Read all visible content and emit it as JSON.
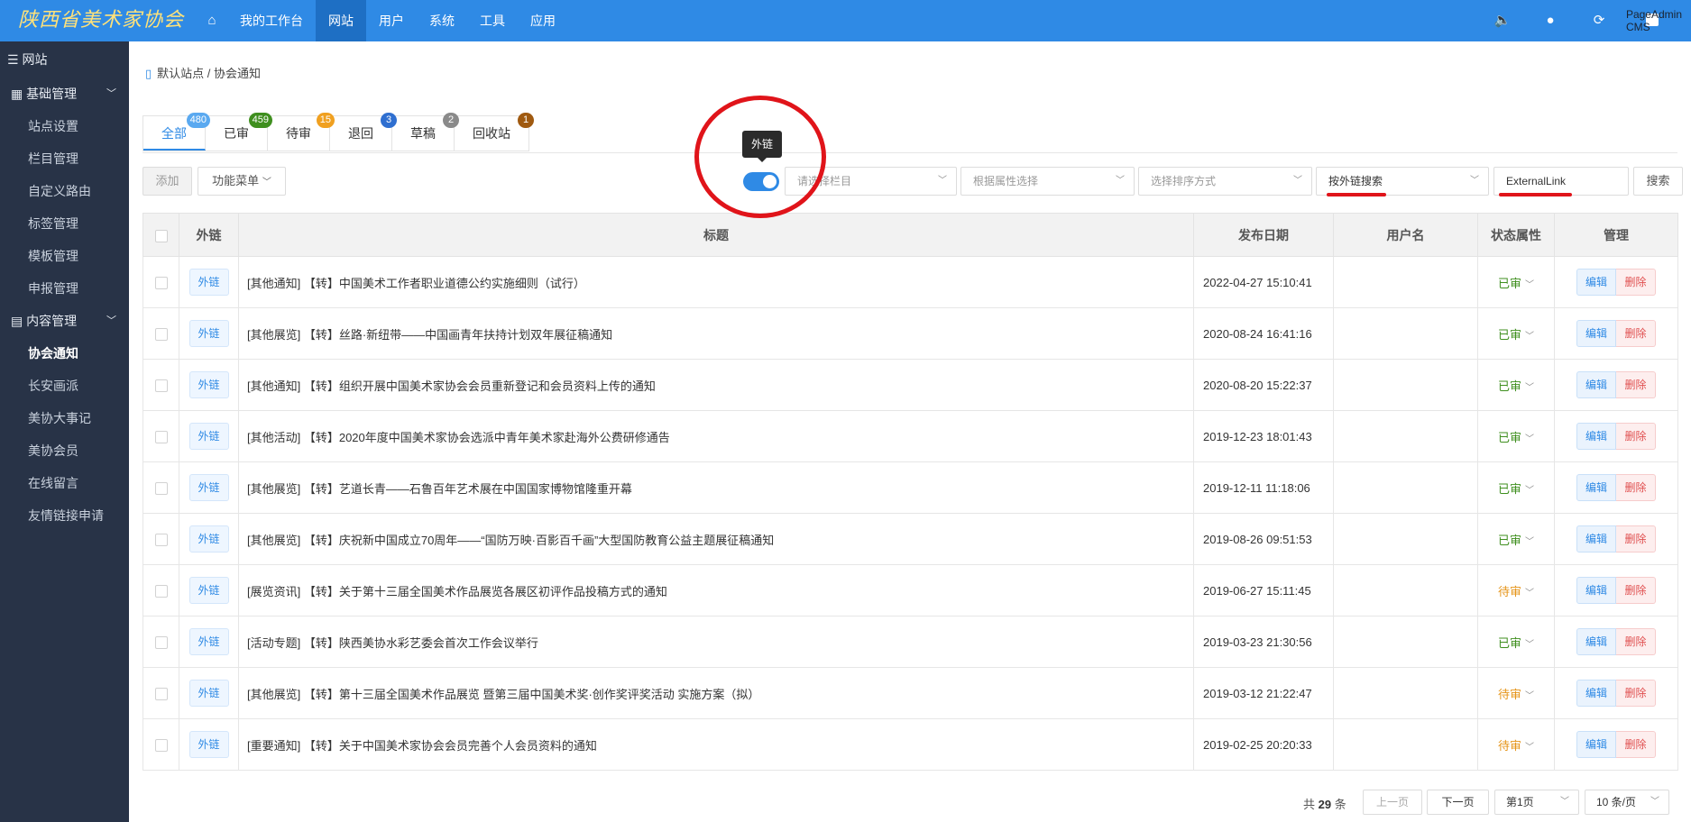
{
  "header": {
    "logo_text": "陕西省美术家协会",
    "nav": [
      "我的工作台",
      "网站",
      "用户",
      "系统",
      "工具",
      "应用"
    ],
    "active_nav": "网站",
    "brand": "PageAdmin CMS"
  },
  "sidebar": {
    "title": "网站",
    "groups": [
      {
        "label": "基础管理",
        "items": [
          "站点设置",
          "栏目管理",
          "自定义路由",
          "标签管理",
          "模板管理",
          "申报管理"
        ]
      },
      {
        "label": "内容管理",
        "items": [
          "协会通知",
          "长安画派",
          "美协大事记",
          "美协会员",
          "在线留言",
          "友情链接申请"
        ]
      }
    ],
    "active_item": "协会通知"
  },
  "breadcrumb": "默认站点 / 协会通知",
  "tabs": [
    {
      "label": "全部",
      "count": "480",
      "color": "#5aa9f0"
    },
    {
      "label": "已审",
      "count": "459",
      "color": "#3f8f1f"
    },
    {
      "label": "待审",
      "count": "15",
      "color": "#f0a020"
    },
    {
      "label": "退回",
      "count": "3",
      "color": "#2f6fd0"
    },
    {
      "label": "草稿",
      "count": "2",
      "color": "#8a8a8a"
    },
    {
      "label": "回收站",
      "count": "1",
      "color": "#a05a10"
    }
  ],
  "toolbar": {
    "add": "添加",
    "func_menu": "功能菜单",
    "tooltip": "外链",
    "select_column": "请选择栏目",
    "select_attr": "根据属性选择",
    "select_sort": "选择排序方式",
    "search_by": "按外链搜索",
    "keyword": "ExternalLink",
    "search": "搜索"
  },
  "table": {
    "headers": [
      "外链",
      "标题",
      "发布日期",
      "用户名",
      "状态属性",
      "管理"
    ],
    "ext_label": "外链",
    "edit_label": "编辑",
    "delete_label": "删除",
    "rows": [
      {
        "title": "[其他通知] 【转】中国美术工作者职业道德公约实施细则（试行）",
        "date": "2022-04-27 15:10:41",
        "user": "",
        "status": "已审"
      },
      {
        "title": "[其他展览] 【转】丝路·新纽带——中国画青年扶持计划双年展征稿通知",
        "date": "2020-08-24 16:41:16",
        "user": "",
        "status": "已审"
      },
      {
        "title": "[其他通知] 【转】组织开展中国美术家协会会员重新登记和会员资料上传的通知",
        "date": "2020-08-20 15:22:37",
        "user": "",
        "status": "已审"
      },
      {
        "title": "[其他活动] 【转】2020年度中国美术家协会选派中青年美术家赴海外公费研修通告",
        "date": "2019-12-23 18:01:43",
        "user": "",
        "status": "已审"
      },
      {
        "title": "[其他展览] 【转】艺道长青——石鲁百年艺术展在中国国家博物馆隆重开幕",
        "date": "2019-12-11 11:18:06",
        "user": "",
        "status": "已审"
      },
      {
        "title": "[其他展览] 【转】庆祝新中国成立70周年——“国防万映·百影百千画”大型国防教育公益主题展征稿通知",
        "date": "2019-08-26 09:51:53",
        "user": "",
        "status": "已审"
      },
      {
        "title": "[展览资讯] 【转】关于第十三届全国美术作品展览各展区初评作品投稿方式的通知",
        "date": "2019-06-27 15:11:45",
        "user": "",
        "status": "待审"
      },
      {
        "title": "[活动专题] 【转】陕西美协水彩艺委会首次工作会议举行",
        "date": "2019-03-23 21:30:56",
        "user": "",
        "status": "已审"
      },
      {
        "title": "[其他展览] 【转】第十三届全国美术作品展览 暨第三届中国美术奖·创作奖评奖活动 实施方案（拟）",
        "date": "2019-03-12 21:22:47",
        "user": "",
        "status": "待审"
      },
      {
        "title": "[重要通知] 【转】关于中国美术家协会会员完善个人会员资料的通知",
        "date": "2019-02-25 20:20:33",
        "user": "",
        "status": "待审"
      }
    ]
  },
  "status_colors": {
    "已审": "#3f8f1f",
    "待审": "#e6951a"
  },
  "pagination": {
    "total_prefix": "共",
    "total": "29",
    "total_suffix": "条",
    "prev": "上一页",
    "next": "下一页",
    "page": "第1页",
    "per_page": "10 条/页"
  }
}
